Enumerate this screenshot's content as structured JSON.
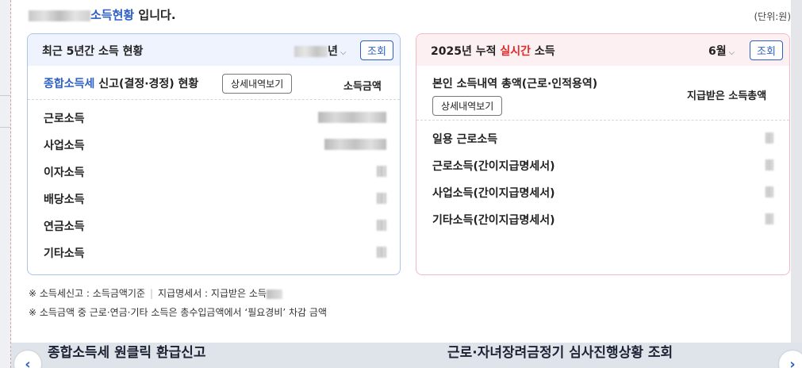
{
  "header": {
    "title_blue": "소득현황",
    "title_suffix": " 입니다.",
    "unit": "(단위:원)"
  },
  "left_card": {
    "title": "최근 5년간 소득 현황",
    "year_suffix": "년",
    "query_label": "조회",
    "subtitle_blue": "종합소득세",
    "subtitle_rest": " 신고(결정·경정) 현황",
    "detail_label": "상세내역보기",
    "col_header": "소득금액",
    "rows": [
      {
        "label": "근로소득"
      },
      {
        "label": "사업소득"
      },
      {
        "label": "이자소득"
      },
      {
        "label": "배당소득"
      },
      {
        "label": "연금소득"
      },
      {
        "label": "기타소득"
      }
    ]
  },
  "right_card": {
    "title_prefix": "2025년 누적 ",
    "title_red": "실시간",
    "title_suffix": " 소득",
    "month": "6월",
    "query_label": "조회",
    "subtitle": "본인 소득내역 총액(근로·인적용역)",
    "detail_label": "상세내역보기",
    "col_header": "지급받은 소득총액",
    "rows": [
      {
        "label": "일용 근로소득"
      },
      {
        "label": "근로소득(간이지급명세서)"
      },
      {
        "label": "사업소득(간이지급명세서)"
      },
      {
        "label": "기타소득(간이지급명세서)"
      }
    ]
  },
  "notes": {
    "line1_a": "※ 소득세신고 : 소득금액기준",
    "line1_b": "지급명세서 : 지급받은 소득",
    "line2": "※ 소득금액 중 근로·연금·기타 소득은 총수입금액에서 ‘필요경비’ 차감 금액"
  },
  "background": {
    "left_banner": "종합소득세 원클릭 환급신고",
    "right_banner": "근로·자녀장려금정기 심사진행상황 조회",
    "prev_icon": "chevron-left-icon",
    "next_icon": "chevron-right-icon"
  },
  "colors": {
    "accent_blue": "#2d5fc4",
    "accent_red": "#e02a2a",
    "left_card_border": "#a9c4ee",
    "right_card_border": "#f3b9c4"
  }
}
